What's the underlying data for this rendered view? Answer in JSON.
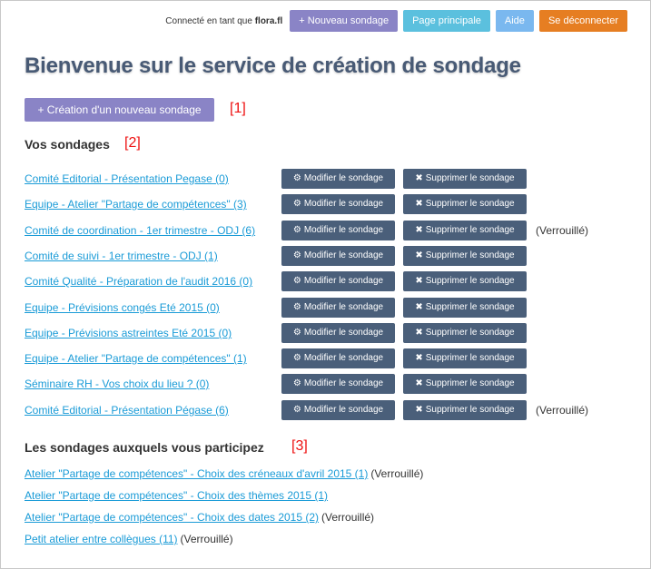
{
  "header": {
    "connected_prefix": "Connecté en tant que",
    "username": "flora.fl",
    "buttons": {
      "new_poll": "+ Nouveau sondage",
      "home": "Page principale",
      "help": "Aide",
      "logout": "Se déconnecter"
    }
  },
  "title": "Bienvenue sur le service de création de sondage",
  "create_button": "+ Création d'un nouveau sondage",
  "markers": {
    "m1": "[1]",
    "m2": "[2]",
    "m3": "[3]"
  },
  "my_polls": {
    "title": "Vos sondages",
    "modify_label": "Modifier le sondage",
    "delete_label": "Supprimer le sondage",
    "items": [
      {
        "label": "Comité Editorial - Présentation Pegase (0)",
        "status": ""
      },
      {
        "label": "Equipe - Atelier \"Partage de compétences\" (3)",
        "status": ""
      },
      {
        "label": "Comité de coordination - 1er trimestre - ODJ (6)",
        "status": "(Verrouillé)"
      },
      {
        "label": "Comité de suivi - 1er trimestre - ODJ (1)",
        "status": ""
      },
      {
        "label": "Comité Qualité - Préparation de l'audit 2016 (0)",
        "status": ""
      },
      {
        "label": "Equipe - Prévisions congés Eté 2015 (0)",
        "status": ""
      },
      {
        "label": "Equipe - Prévisions astreintes Eté 2015 (0)",
        "status": ""
      },
      {
        "label": "Equipe - Atelier \"Partage de compétences\" (1)",
        "status": ""
      },
      {
        "label": "Séminaire RH - Vos choix du lieu ? (0)",
        "status": ""
      },
      {
        "label": "Comité Editorial - Présentation Pégase (6)",
        "status": "(Verrouillé)"
      }
    ]
  },
  "participating": {
    "title": "Les sondages auxquels vous participez",
    "items": [
      {
        "label": "Atelier \"Partage de compétences\" - Choix des créneaux d'avril 2015 (1)",
        "status": "(Verrouillé)"
      },
      {
        "label": "Atelier \"Partage de compétences\" - Choix des thèmes 2015 (1)",
        "status": ""
      },
      {
        "label": "Atelier \"Partage de compétences\" - Choix des dates 2015 (2)",
        "status": "(Verrouillé)"
      },
      {
        "label": "Petit atelier entre collègues (11)",
        "status": "(Verrouillé)"
      }
    ]
  }
}
